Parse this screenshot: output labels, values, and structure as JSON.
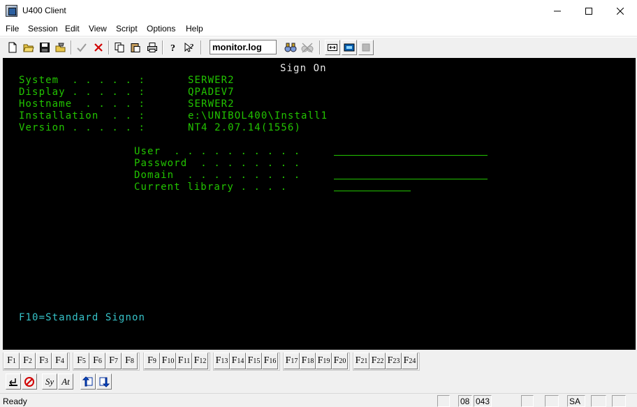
{
  "window": {
    "title": "U400 Client"
  },
  "menu": [
    "File",
    "Session",
    "Edit",
    "View",
    "Script",
    "Options",
    "Help"
  ],
  "toolbar": {
    "log_file": "monitor.log"
  },
  "terminal": {
    "screen_title": "Sign On",
    "info": [
      {
        "label": "System  . . . . . :",
        "value": "SERWER2"
      },
      {
        "label": "Display . . . . . :",
        "value": "QPADEV7"
      },
      {
        "label": "Hostname  . . . . :",
        "value": "SERWER2"
      },
      {
        "label": "Installation  . . :",
        "value": "e:\\UNIBOL400\\Install1"
      },
      {
        "label": "Version . . . . . :",
        "value": "NT4 2.07.14(1556)"
      }
    ],
    "prompts": [
      {
        "label": "User  . . . . . . . . . ."
      },
      {
        "label": "Password  . . . . . . . ."
      },
      {
        "label": "Domain  . . . . . . . . ."
      },
      {
        "label": "Current library . . . ."
      }
    ],
    "footer": "F10=Standard Signon",
    "colors": {
      "background": "#000000",
      "field": "#22c400",
      "title": "#e8e8e8",
      "footer": "#36c2c8"
    }
  },
  "fkeys": [
    [
      "F",
      "1"
    ],
    [
      "F",
      "2"
    ],
    [
      "F",
      "3"
    ],
    [
      "F",
      "4"
    ],
    [
      "F",
      "5"
    ],
    [
      "F",
      "6"
    ],
    [
      "F",
      "7"
    ],
    [
      "F",
      "8"
    ],
    [
      "F",
      "9"
    ],
    [
      "F",
      "10"
    ],
    [
      "F",
      "11"
    ],
    [
      "F",
      "12"
    ],
    [
      "F",
      "13"
    ],
    [
      "F",
      "14"
    ],
    [
      "F",
      "15"
    ],
    [
      "F",
      "16"
    ],
    [
      "F",
      "17"
    ],
    [
      "F",
      "18"
    ],
    [
      "F",
      "19"
    ],
    [
      "F",
      "20"
    ],
    [
      "F",
      "21"
    ],
    [
      "F",
      "22"
    ],
    [
      "F",
      "23"
    ],
    [
      "F",
      "24"
    ]
  ],
  "bottom_tools": {
    "sys_label": "Sy",
    "attn_label": "At"
  },
  "status": {
    "text": "Ready",
    "row": "08",
    "col": "043",
    "mode": "SA"
  }
}
